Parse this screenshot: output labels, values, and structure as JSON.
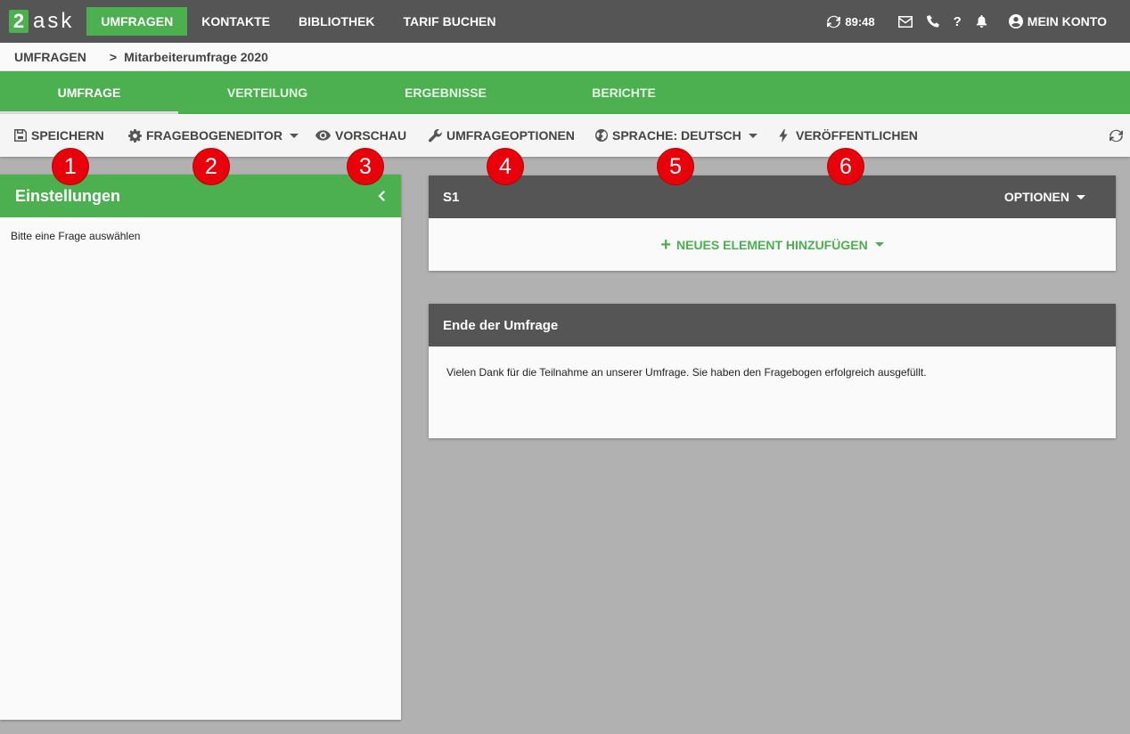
{
  "logo": {
    "digit": "2",
    "text": "ask"
  },
  "topnav": {
    "items": [
      {
        "label": "UMFRAGEN",
        "active": true
      },
      {
        "label": "KONTAKTE",
        "active": false
      },
      {
        "label": "BIBLIOTHEK",
        "active": false
      },
      {
        "label": "TARIF BUCHEN",
        "active": false
      }
    ]
  },
  "topright": {
    "timer": "89:48",
    "help": "?",
    "account": "MEIN KONTO"
  },
  "breadcrumb": {
    "root": "UMFRAGEN",
    "separator": ">",
    "current": "Mitarbeiterumfrage 2020"
  },
  "tabs": [
    {
      "label": "UMFRAGE",
      "active": true
    },
    {
      "label": "VERTEILUNG",
      "active": false
    },
    {
      "label": "ERGEBNISSE",
      "active": false
    },
    {
      "label": "BERICHTE",
      "active": false
    }
  ],
  "toolbar": {
    "save": "SPEICHERN",
    "editor": "FRAGEBOGENEDITOR",
    "preview": "VORSCHAU",
    "options": "UMFRAGEOPTIONEN",
    "language": "SPRACHE: DEUTSCH",
    "publish": "VERÖFFENTLICHEN"
  },
  "badges": [
    "1",
    "2",
    "3",
    "4",
    "5",
    "6"
  ],
  "settings_panel": {
    "title": "Einstellungen",
    "hint": "Bitte eine Frage auswählen"
  },
  "section_card": {
    "title": "S1",
    "options": "OPTIONEN",
    "add_element": "NEUES ELEMENT HINZUFÜGEN"
  },
  "end_card": {
    "title": "Ende der Umfrage",
    "text": "Vielen Dank für die Teilnahme an unserer Umfrage. Sie haben den Fragebogen erfolgreich ausgefüllt."
  },
  "colors": {
    "brand_green": "#4caf50",
    "dark_bar": "#555555",
    "badge_red": "#e8000b",
    "background": "#b1b1b1"
  }
}
